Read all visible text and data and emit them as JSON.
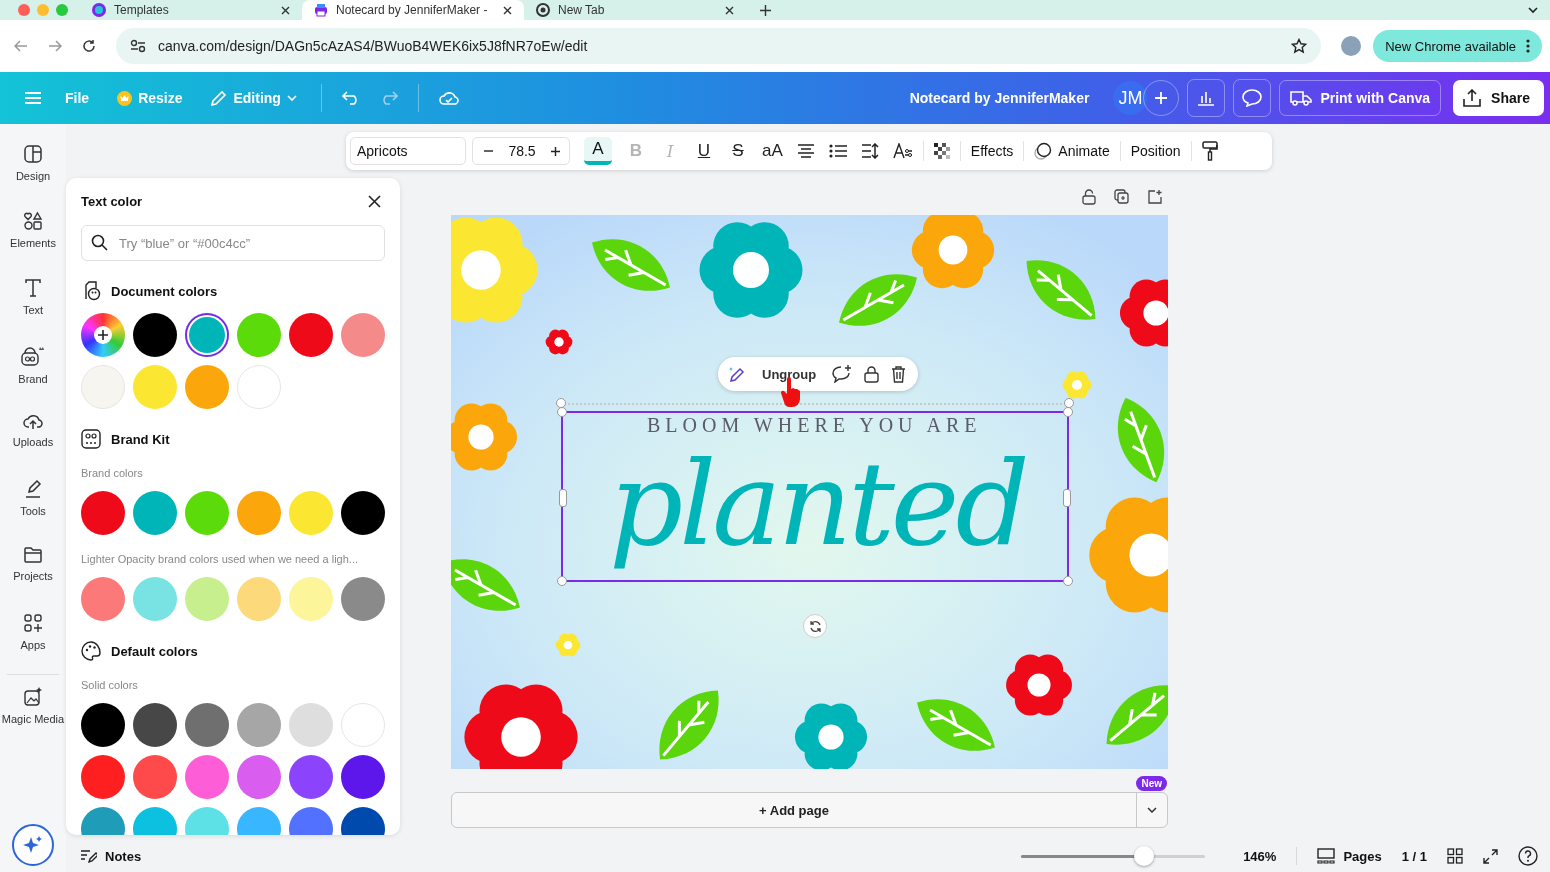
{
  "browser": {
    "tabs": [
      {
        "title": "Templates",
        "kind": "canva",
        "selected": false
      },
      {
        "title": "Notecard by JenniferMaker -",
        "kind": "print",
        "selected": true
      },
      {
        "title": "New Tab",
        "kind": "chrome",
        "selected": false
      }
    ],
    "url": "canva.com/design/DAGn5cAzAS4/BWuoB4WEK6ix5J8fNR7oEw/edit",
    "update_button": "New Chrome available"
  },
  "header": {
    "file": "File",
    "resize": "Resize",
    "mode": "Editing",
    "title": "Notecard by JenniferMaker",
    "avatar": "JM",
    "print": "Print with Canva",
    "share": "Share"
  },
  "toolbar": {
    "font": "Apricots",
    "font_size": "78.5",
    "text_color_button": {
      "label": "A",
      "active": true
    },
    "format": [
      {
        "kind": "bold",
        "label": "B",
        "disabled": true
      },
      {
        "kind": "italic",
        "label": "I",
        "disabled": true
      },
      {
        "kind": "underline",
        "label": "U",
        "disabled": false
      },
      {
        "kind": "strike",
        "label": "S",
        "disabled": false
      },
      {
        "kind": "case",
        "label": "aA",
        "disabled": false
      }
    ],
    "effects": "Effects",
    "animate": "Animate",
    "position": "Position"
  },
  "rail": [
    {
      "kind": "design",
      "label": "Design"
    },
    {
      "kind": "elements",
      "label": "Elements"
    },
    {
      "kind": "text",
      "label": "Text"
    },
    {
      "kind": "brand",
      "label": "Brand"
    },
    {
      "kind": "uploads",
      "label": "Uploads"
    },
    {
      "kind": "tools",
      "label": "Tools"
    },
    {
      "kind": "projects",
      "label": "Projects"
    },
    {
      "kind": "apps",
      "label": "Apps"
    },
    {
      "kind": "magic",
      "label": "Magic Media"
    }
  ],
  "panel": {
    "title": "Text color",
    "search_placeholder": "Try “blue” or “#00c4cc”",
    "document_title": "Document colors",
    "document_colors": [
      {
        "kind": "add",
        "selected": false
      },
      {
        "kind": "swatch",
        "color": "#000000",
        "selected": false
      },
      {
        "kind": "swatch",
        "color": "#00b5b8",
        "selected": true
      },
      {
        "kind": "swatch",
        "color": "#5cdb0a",
        "selected": false
      },
      {
        "kind": "swatch",
        "color": "#ee0a19",
        "selected": false
      },
      {
        "kind": "swatch",
        "color": "#f58a8a",
        "selected": false
      },
      {
        "kind": "swatch",
        "color": "#f7f5f0",
        "selected": false
      },
      {
        "kind": "swatch",
        "color": "#fbe731",
        "selected": false
      },
      {
        "kind": "swatch",
        "color": "#fba60a",
        "selected": false
      },
      {
        "kind": "swatch",
        "color": "#ffffff",
        "selected": false
      }
    ],
    "brand_title": "Brand Kit",
    "brand_subtitle": "Brand colors",
    "brand_colors": [
      {
        "color": "#ee0a19"
      },
      {
        "color": "#00b5b8"
      },
      {
        "color": "#5cdb0a"
      },
      {
        "color": "#fba60a"
      },
      {
        "color": "#fbe731"
      },
      {
        "color": "#000000"
      }
    ],
    "lighter_subtitle": "Lighter Opacity brand colors used when we need a ligh...",
    "lighter_colors": [
      {
        "color": "#fb7a79"
      },
      {
        "color": "#79e3e3"
      },
      {
        "color": "#c8ef8e"
      },
      {
        "color": "#fcd97a"
      },
      {
        "color": "#fcf59a"
      },
      {
        "color": "#8a8a8a"
      }
    ],
    "default_title": "Default colors",
    "solid_subtitle": "Solid colors",
    "solid_colors": [
      {
        "color": "#000000"
      },
      {
        "color": "#474747"
      },
      {
        "color": "#6f6f6f"
      },
      {
        "color": "#a6a6a6"
      },
      {
        "color": "#dedede"
      },
      {
        "color": "#ffffff"
      },
      {
        "color": "#fe2020"
      },
      {
        "color": "#fe4a4a"
      },
      {
        "color": "#fd5ed8"
      },
      {
        "color": "#d95ef0"
      },
      {
        "color": "#8c43fc"
      },
      {
        "color": "#5e17eb"
      },
      {
        "color": "#1f9cb8"
      },
      {
        "color": "#0cc0df"
      },
      {
        "color": "#5de0e6"
      },
      {
        "color": "#38b6ff"
      },
      {
        "color": "#5271ff"
      },
      {
        "color": "#004aad"
      }
    ]
  },
  "canvas": {
    "subtitle": "BLOOM WHERE YOU ARE",
    "title": "planted",
    "context_action": "Ungroup"
  },
  "add_page": {
    "label": "+ Add page",
    "badge": "New"
  },
  "footer": {
    "notes": "Notes",
    "zoom": {
      "level": 0.67
    },
    "zoom_reading": "146%",
    "pages": "Pages",
    "page_count": "1 / 1"
  }
}
